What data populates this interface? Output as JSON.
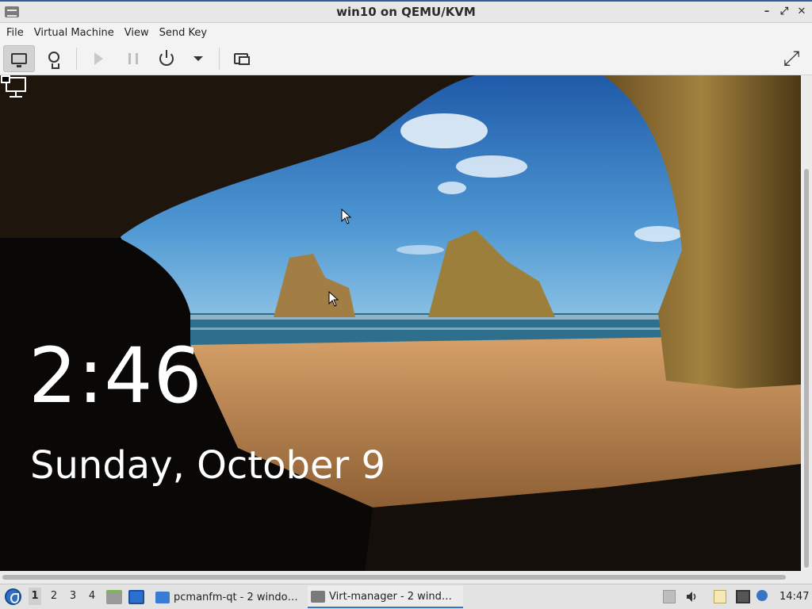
{
  "window": {
    "title": "win10 on QEMU/KVM",
    "controls": {
      "minimize": "–",
      "maximize": "⤢",
      "close": "✕"
    }
  },
  "menubar": {
    "items": [
      "File",
      "Virtual Machine",
      "View",
      "Send Key"
    ]
  },
  "toolbar": {
    "buttons": [
      "monitor-icon",
      "lightbulb-icon",
      "play-icon",
      "pause-icon",
      "power-icon",
      "dropdown-caret-icon",
      "screens-icon",
      "fullscreen-icon"
    ],
    "active": "monitor-icon"
  },
  "vm": {
    "lockscreen": {
      "time": "2:46",
      "date": "Sunday, October 9"
    }
  },
  "taskbar": {
    "workspaces": [
      "1",
      "2",
      "3",
      "4"
    ],
    "current_workspace": "1",
    "tasks": [
      {
        "label": "pcmanfm-qt - 2 windo…",
        "icon": "folder-icon",
        "active": false
      },
      {
        "label": "Virt-manager - 2 wind…",
        "icon": "virt-manager-icon",
        "active": true
      }
    ],
    "clock": "14:47"
  },
  "colors": {
    "sky": "#3f86c8",
    "sea": "#1f5f7a",
    "sand": "#c8925a",
    "rock": "#8a6a2f",
    "cave": "#0b0906",
    "taskbar_accent": "#3a75c4"
  }
}
